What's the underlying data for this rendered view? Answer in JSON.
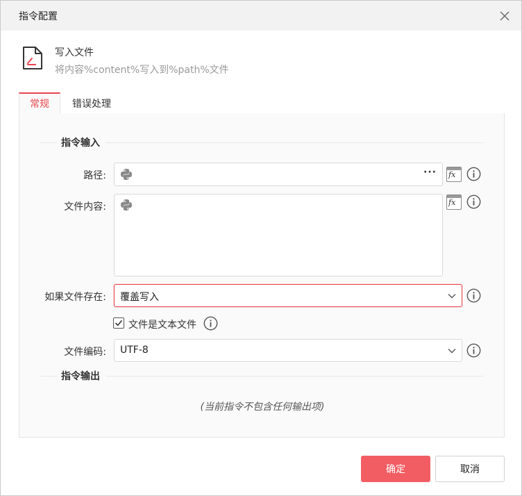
{
  "dialog": {
    "title": "指令配置"
  },
  "command": {
    "name": "写入文件",
    "description": "将内容%content%写入到%path%文件"
  },
  "tabs": [
    {
      "label": "常规",
      "active": true
    },
    {
      "label": "错误处理",
      "active": false
    }
  ],
  "input_section": {
    "title": "指令输入",
    "path": {
      "label": "路径:",
      "value": "",
      "more": "···"
    },
    "content": {
      "label": "文件内容:",
      "value": ""
    },
    "if_exists": {
      "label": "如果文件存在:",
      "value": "覆盖写入"
    },
    "is_text_file": {
      "label": "文件是文本文件",
      "checked": true
    },
    "encoding": {
      "label": "文件编码:",
      "value": "UTF-8"
    }
  },
  "output_section": {
    "title": "指令输出",
    "empty_text": "(当前指令不包含任何输出项)"
  },
  "buttons": {
    "ok": "确定",
    "cancel": "取消"
  },
  "colors": {
    "accent": "#e8454d",
    "ok_button": "#f25d63"
  }
}
